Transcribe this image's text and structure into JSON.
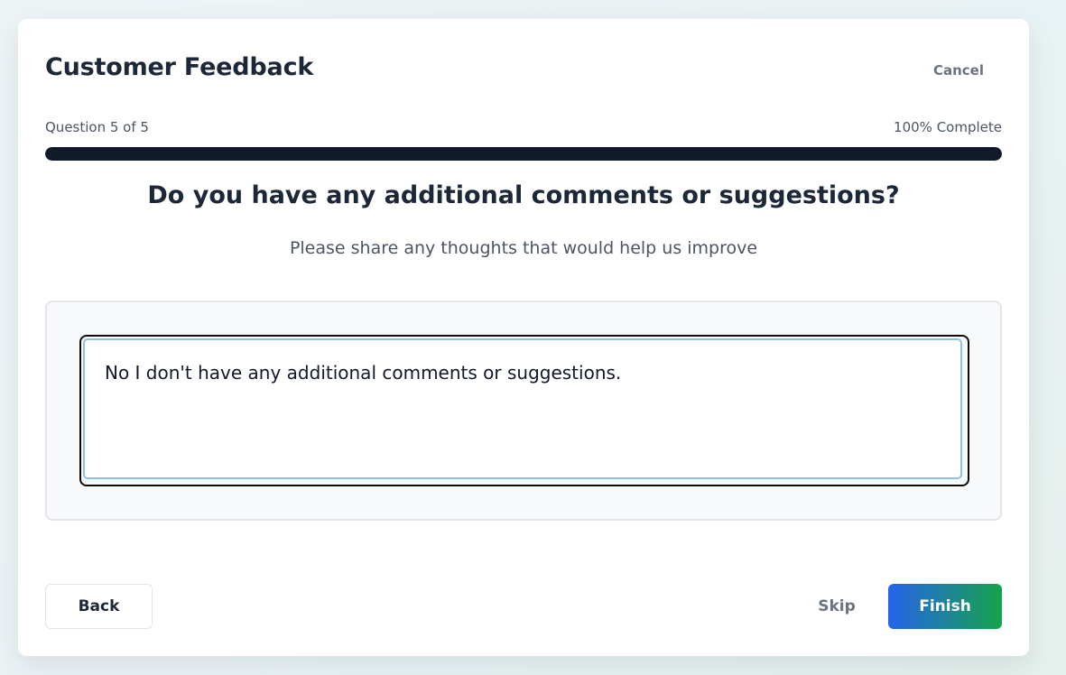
{
  "header": {
    "title": "Customer Feedback",
    "cancel_label": "Cancel"
  },
  "progress": {
    "question_label": "Question 5 of 5",
    "complete_label": "100% Complete",
    "percent": 100
  },
  "question": {
    "text": "Do you have any additional comments or suggestions?",
    "subtitle": "Please share any thoughts that would help us improve"
  },
  "answer": {
    "value": "No I don't have any additional comments or suggestions."
  },
  "footer": {
    "back_label": "Back",
    "skip_label": "Skip",
    "finish_label": "Finish"
  },
  "colors": {
    "progress_fill": "#111a2b",
    "finish_gradient_start": "#2563eb",
    "finish_gradient_end": "#16a34a",
    "focus_ring": "#8fc1e8"
  }
}
